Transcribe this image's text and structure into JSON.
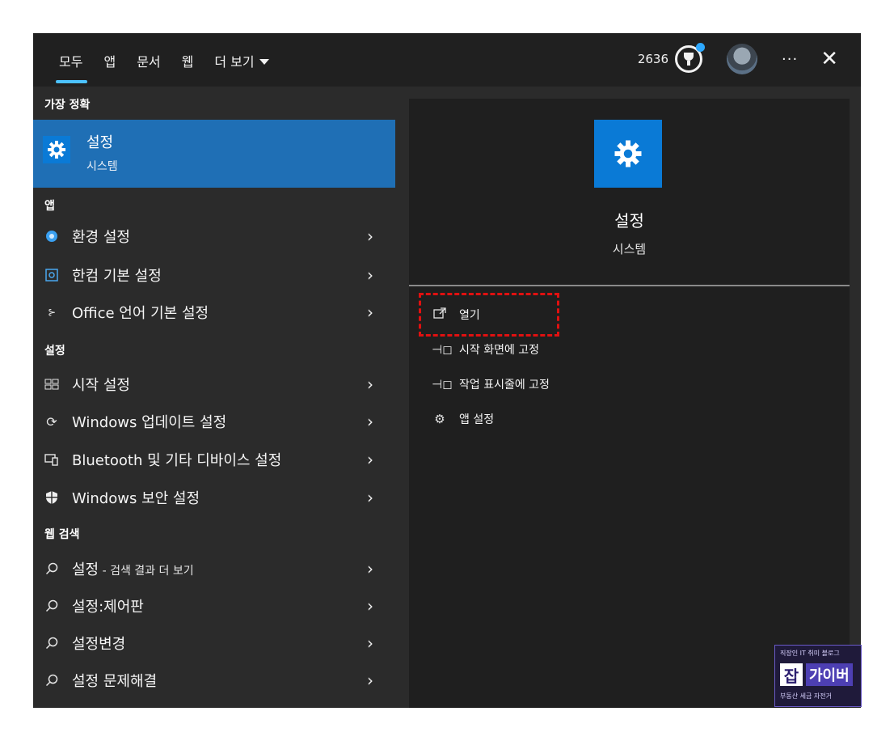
{
  "header": {
    "tabs": [
      "모두",
      "앱",
      "문서",
      "웹"
    ],
    "more_label": "더 보기",
    "points": "2636"
  },
  "sections": {
    "best_match": "가장 정확",
    "apps": "앱",
    "settings": "설정",
    "web": "웹 검색"
  },
  "best_match": {
    "title": "설정",
    "subtitle": "시스템"
  },
  "apps": [
    {
      "label": "환경 설정",
      "icon": "gear-blue-icon"
    },
    {
      "label": "한컴 기본 설정",
      "icon": "hancom-icon"
    },
    {
      "label": "Office 언어 기본 설정",
      "icon": "office-language-icon"
    }
  ],
  "settings": [
    {
      "label": "시작 설정",
      "icon": "start-icon"
    },
    {
      "label": "Windows 업데이트 설정",
      "icon": "refresh-icon"
    },
    {
      "label": "Bluetooth 및 기타 디바이스 설정",
      "icon": "devices-icon"
    },
    {
      "label": "Windows 보안 설정",
      "icon": "shield-icon"
    }
  ],
  "web": [
    {
      "label": "설정",
      "suffix": " - 검색 결과 더 보기"
    },
    {
      "label": "설정:제어판",
      "suffix": ""
    },
    {
      "label": "설정변경",
      "suffix": ""
    },
    {
      "label": "설정 문제해결",
      "suffix": ""
    }
  ],
  "detail": {
    "title": "설정",
    "subtitle": "시스템",
    "actions": [
      "열기",
      "시작 화면에 고정",
      "작업 표시줄에 고정",
      "앱 설정"
    ]
  },
  "watermark": {
    "top": "직장인 IT 취미 블로그",
    "badge_a": "잡",
    "badge_b": "가이버",
    "bottom": "부동산 세금 자전거"
  },
  "colors": {
    "selection": "#1f6fb5",
    "accent": "#4cc2ff",
    "settings_icon_bg": "#0a7ad6",
    "highlight": "#e01010"
  }
}
